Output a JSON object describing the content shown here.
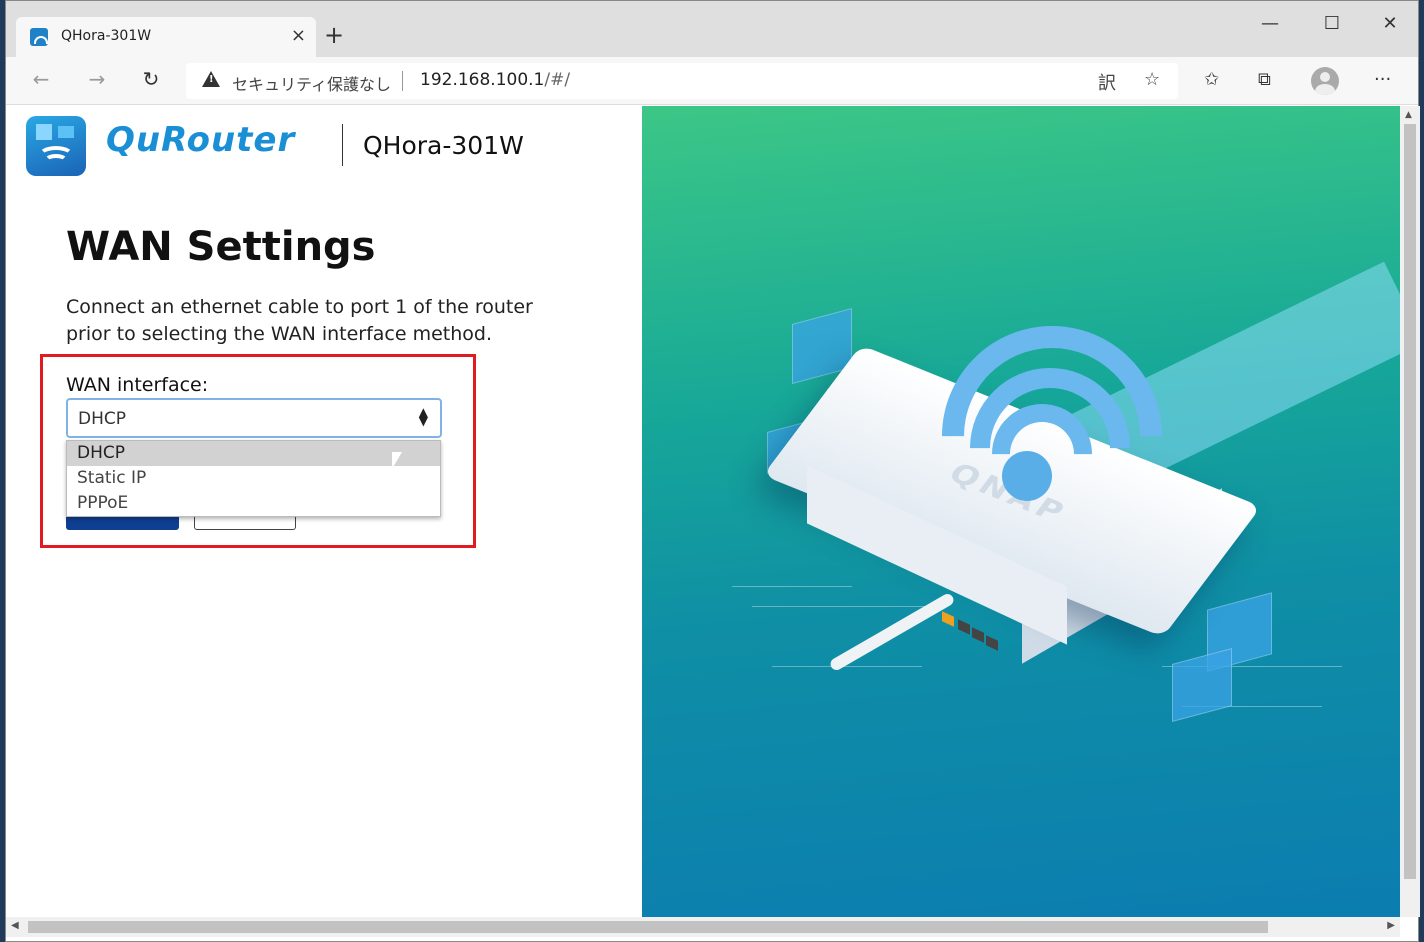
{
  "browser": {
    "tab_title": "QHora-301W",
    "tab_close": "×",
    "new_tab": "+",
    "window_minimize": "—",
    "window_maximize": "☐",
    "window_close": "✕",
    "security_label": "セキュリティ保護なし",
    "url_host": "192.168.100.1",
    "url_path": "/#/",
    "icons": [
      "back-icon",
      "forward-icon",
      "reload-icon",
      "not-secure-icon",
      "translate-icon",
      "favorite-star-icon",
      "favorites-list-icon",
      "collections-icon",
      "profile-icon",
      "more-icon"
    ]
  },
  "header": {
    "brand": "QuRouter",
    "model": "QHora-301W"
  },
  "wan": {
    "title": "WAN Settings",
    "description": "Connect an ethernet cable to port 1 of the router prior to selecting the WAN interface method.",
    "field_label": "WAN interface:",
    "selected": "DHCP",
    "options": [
      "DHCP",
      "Static IP",
      "PPPoE"
    ]
  },
  "colors": {
    "accent": "#0f3f92",
    "highlight": "#e11b22",
    "brand": "#1a8fd6"
  }
}
